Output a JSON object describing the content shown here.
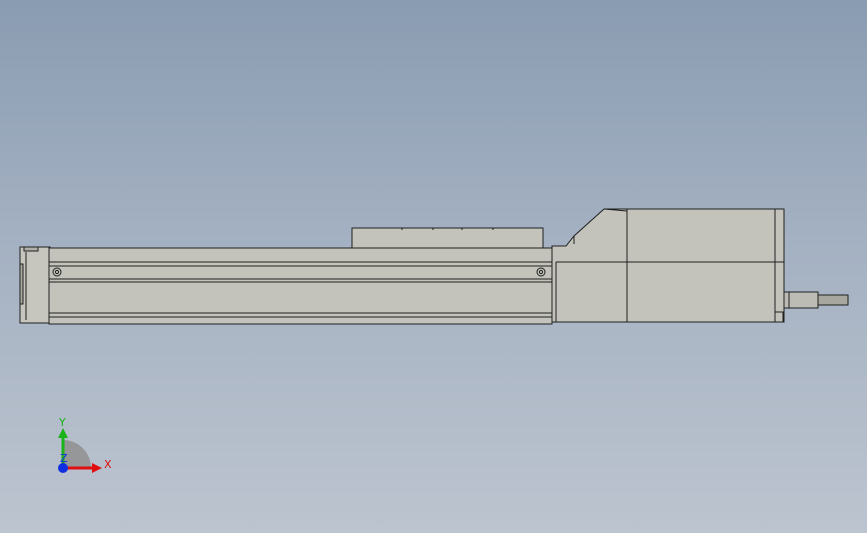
{
  "viewport": {
    "background_top": "#8a9cb2",
    "background_bottom": "#bcc4cf"
  },
  "model": {
    "body_color": "#c3c3bc",
    "body_shade": "#b5b5ae",
    "edge_color": "#1f1f1f"
  },
  "triad": {
    "x_label": "X",
    "y_label": "Y",
    "z_label": "Z",
    "x_color": "#e01010",
    "y_color": "#19b219",
    "z_color": "#1030e0"
  }
}
